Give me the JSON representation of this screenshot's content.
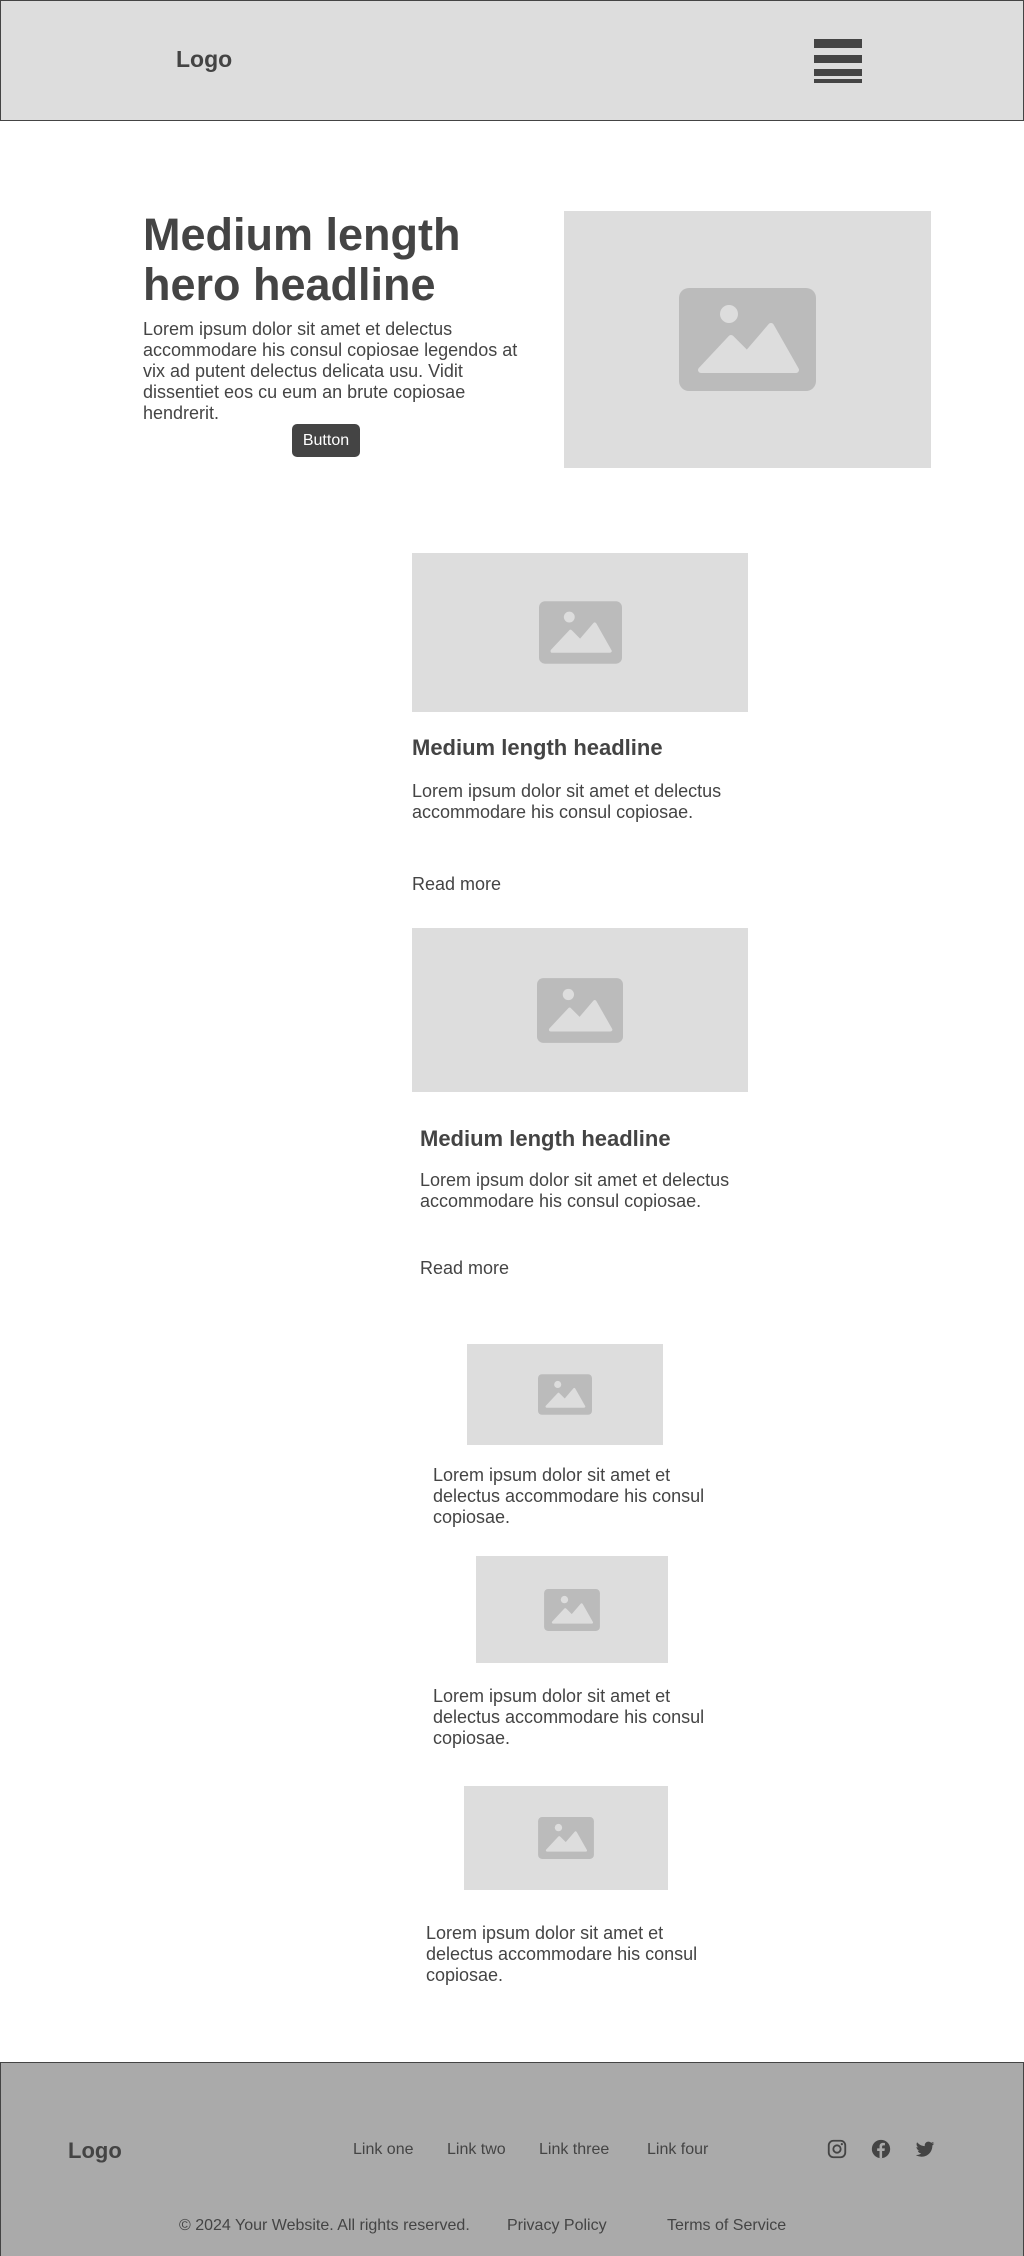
{
  "header": {
    "logo": "Logo",
    "menu_icon": "hamburger-menu-icon"
  },
  "hero": {
    "headline": "Medium length hero headline",
    "body": "Lorem ipsum dolor sit amet et delectus accommodare his consul copiosae legendos at vix ad putent delectus delicata usu. Vidit dissentiet eos cu eum an brute copiosae hendrerit.",
    "button_label": "Button",
    "image_icon": "image-placeholder-icon"
  },
  "cards": [
    {
      "headline": "Medium length headline",
      "body": "Lorem ipsum dolor sit amet et delectus accommodare his consul copiosae.",
      "link": "Read more"
    },
    {
      "headline": "Medium length headline",
      "body": "Lorem ipsum dolor sit amet et delectus accommodare his consul copiosae.",
      "link": "Read more"
    }
  ],
  "small_items": [
    {
      "body": "Lorem ipsum dolor sit amet et delectus accommodare his consul copiosae."
    },
    {
      "body": "Lorem ipsum dolor sit amet et delectus accommodare his consul copiosae."
    },
    {
      "body": "Lorem ipsum dolor sit amet et delectus accommodare his consul copiosae."
    }
  ],
  "footer": {
    "logo": "Logo",
    "links": [
      "Link one",
      "Link two",
      "Link three",
      "Link four"
    ],
    "social_icons": [
      "instagram-icon",
      "facebook-icon",
      "twitter-icon"
    ],
    "copyright": "© 2024 Your Website. All rights reserved.",
    "privacy": "Privacy Policy",
    "terms": "Terms of Service"
  },
  "colors": {
    "placeholder_bg": "#dddddd",
    "placeholder_icon": "#bbbbbb",
    "text": "#444444",
    "footer_bg": "#aaaaaa",
    "button_bg": "#444444"
  }
}
